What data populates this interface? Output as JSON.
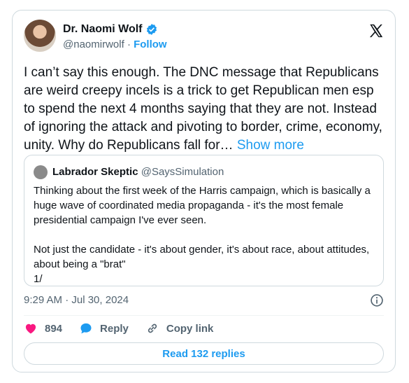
{
  "tweet": {
    "author_name": "Dr. Naomi Wolf",
    "author_handle": "@naomirwolf",
    "separator": "·",
    "follow_label": "Follow",
    "text": "I can’t say this enough. The DNC message that Republicans are weird creepy incels is a trick to get Republican men esp to spend the next 4 months saying that they are not. Instead of ignoring the attack and pivoting to border, crime, economy, unity. Why do Republicans fall for…",
    "show_more_label": "Show more",
    "timestamp": "9:29 AM · Jul 30, 2024"
  },
  "quote": {
    "author_name": "Labrador Skeptic",
    "author_handle": "@SaysSimulation",
    "paragraph1": "Thinking about the first week of the Harris campaign, which is basically a huge wave of coordinated media propaganda - it's the most female presidential campaign I've ever seen.",
    "paragraph2": "Not just the candidate - it's about gender, it's about race, about attitudes, about being a \"brat\"",
    "paragraph3": "1/"
  },
  "actions": {
    "like_count": "894",
    "reply_label": "Reply",
    "copy_link_label": "Copy link"
  },
  "read_replies_label": "Read 132 replies",
  "colors": {
    "accent": "#1d9bf0",
    "like": "#f91880",
    "muted": "#536471"
  },
  "icons": [
    "verified-icon",
    "x-logo-icon",
    "info-icon",
    "heart-icon",
    "reply-icon",
    "link-icon"
  ]
}
